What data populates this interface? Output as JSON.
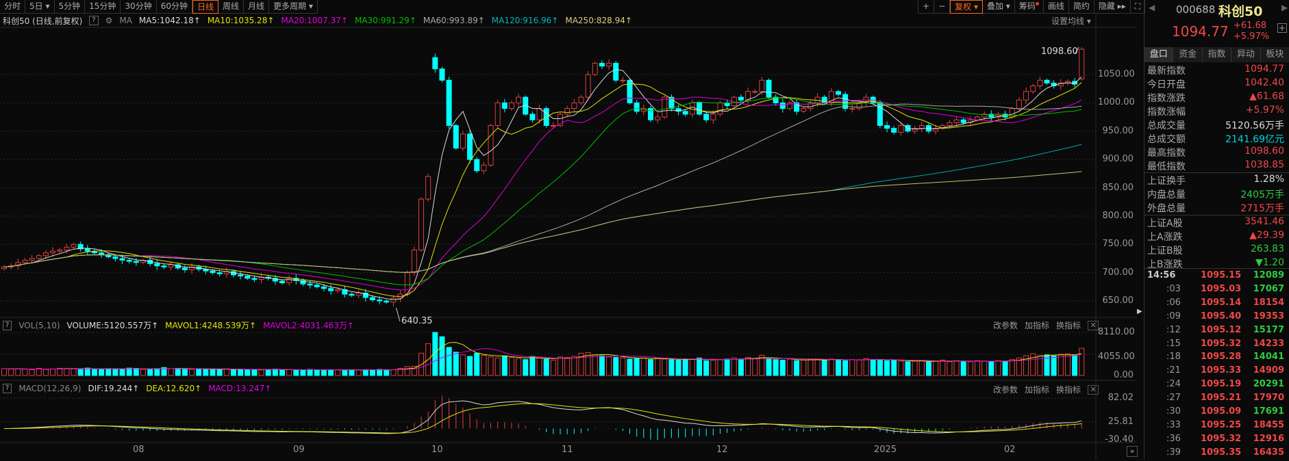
{
  "toolbar": {
    "periods": [
      "分时",
      "5日 ▾",
      "5分钟",
      "15分钟",
      "30分钟",
      "60分钟",
      "日线",
      "周线",
      "月线",
      "更多周期 ▾"
    ],
    "active_period": "日线",
    "right": {
      "plus": "+",
      "minus": "−",
      "fuquan": "复权 ▾",
      "overlay": "叠加 ▾",
      "chips": "筹码",
      "draw": "画线",
      "simple": "简约",
      "hide": "隐藏 ▸▸",
      "fullscreen": "⛶"
    }
  },
  "info": {
    "title": "科创50 (日线,前复权)",
    "help": "?",
    "ma_label": "MA",
    "ma5": "MA5:1042.18↑",
    "ma10": "MA10:1035.28↑",
    "ma20": "MA20:1007.37↑",
    "ma30": "MA30:991.29↑",
    "ma60": "MA60:993.89↑",
    "ma120": "MA120:916.96↑",
    "ma250": "MA250:828.94↑",
    "set_ma": "设置均线 ▾"
  },
  "colors": {
    "up": "#e04040",
    "down": "#00ffff",
    "ma5": "#dddddd",
    "ma10": "#e6e600",
    "ma20": "#e000e0",
    "ma30": "#00c000",
    "ma60": "#aaaaaa",
    "ma120": "#00a8b0",
    "ma250": "#c8c070"
  },
  "price_axis": [
    "1050.00",
    "1000.00",
    "950.00",
    "900.00",
    "850.00",
    "800.00",
    "750.00",
    "700.00",
    "650.00"
  ],
  "annotations": {
    "high": "1098.60",
    "low": "640.35"
  },
  "vol": {
    "help": "?",
    "name": "VOL(5,10)",
    "volume": "VOLUME:5120.557万↑",
    "mavol1": "MAVOL1:4248.539万↑",
    "mavol2": "MAVOL2:4031.463万↑",
    "axis": [
      "8110.00",
      "4055.00",
      "0.00"
    ]
  },
  "macd": {
    "help": "?",
    "name": "MACD(12,26,9)",
    "dif": "DIF:19.244↑",
    "dea": "DEA:12.620↑",
    "macd": "MACD:13.247↑",
    "axis": [
      "82.02",
      "25.81",
      "-30.40"
    ]
  },
  "sub_buttons": {
    "params": "改参数",
    "add": "加指标",
    "swap": "换指标",
    "close": "✕"
  },
  "months": [
    "08",
    "09",
    "10",
    "11",
    "12",
    "2025",
    "02"
  ],
  "chart_data": {
    "type": "candlestick",
    "y_range": [
      620,
      1110
    ],
    "closes": [
      710,
      712,
      718,
      722,
      725,
      730,
      735,
      738,
      740,
      745,
      750,
      742,
      738,
      735,
      732,
      728,
      725,
      722,
      720,
      718,
      722,
      716,
      712,
      710,
      714,
      708,
      705,
      710,
      706,
      703,
      700,
      698,
      702,
      696,
      694,
      690,
      688,
      692,
      690,
      685,
      682,
      690,
      686,
      680,
      678,
      675,
      672,
      668,
      670,
      662,
      660,
      664,
      656,
      652,
      650,
      648,
      655,
      662,
      700,
      740,
      830,
      870,
      1060,
      1040,
      960,
      920,
      945,
      900,
      880,
      890,
      960,
      1000,
      990,
      1000,
      1010,
      980,
      970,
      990,
      960,
      960,
      980,
      990,
      1000,
      1010,
      1050,
      1070,
      1065,
      1070,
      1040,
      1040,
      1000,
      985,
      990,
      970,
      975,
      1010,
      990,
      985,
      980,
      1000,
      980,
      970,
      980,
      1000,
      995,
      1010,
      1005,
      1020,
      1020,
      1040,
      1010,
      1000,
      990,
      1000,
      985,
      990,
      1000,
      1010,
      1000,
      1020,
      1015,
      990,
      990,
      1000,
      1010,
      1000,
      960,
      955,
      948,
      960,
      950,
      955,
      960,
      950,
      955,
      960,
      965,
      970,
      965,
      970,
      975,
      980,
      975,
      980,
      975,
      990,
      1005,
      1020,
      1030,
      1040,
      1035,
      1030,
      1035,
      1038,
      1033,
      1094.77
    ],
    "volumes": [
      1300,
      1200,
      1250,
      1200,
      1100,
      1350,
      1150,
      1250,
      1350,
      1300,
      1300,
      1200,
      1400,
      1250,
      1150,
      1300,
      1250,
      1150,
      1400,
      1350,
      1150,
      1200,
      1300,
      1500,
      1300,
      1350,
      1250,
      1150,
      1300,
      1200,
      1100,
      1150,
      1250,
      1100,
      1200,
      1100,
      1150,
      1050,
      1100,
      1200,
      1050,
      1100,
      1000,
      1050,
      1150,
      1100,
      1050,
      1100,
      1050,
      1000,
      1100,
      1050,
      1100,
      1050,
      1150,
      1050,
      1100,
      1350,
      1700,
      1750,
      4200,
      6000,
      8110,
      7300,
      5300,
      4400,
      3900,
      3600,
      4200,
      3800,
      3500,
      3300,
      3700,
      3400,
      3200,
      3000,
      3600,
      3300,
      3100,
      2900,
      3500,
      3400,
      3600,
      4200,
      4300,
      3900,
      3700,
      3500,
      3400,
      3300,
      3100,
      3200,
      3300,
      3000,
      3300,
      3100,
      3000,
      2900,
      3100,
      3000,
      3300,
      2800,
      2900,
      3000,
      3100,
      3300,
      3100,
      3400,
      3200,
      3800,
      3200,
      3000,
      2900,
      3100,
      2800,
      2900,
      3000,
      3100,
      2900,
      3100,
      3000,
      2800,
      3000,
      2900,
      3200,
      3000,
      3000,
      2800,
      2900,
      2700,
      2600,
      2700,
      2800,
      2600,
      2700,
      2900,
      2600,
      2800,
      2700,
      2600,
      2800,
      2700,
      2600,
      2800,
      2700,
      3000,
      3300,
      3700,
      4100,
      3800,
      3900,
      3700,
      4000,
      4100,
      3800,
      5120
    ],
    "last_open": 1042.4,
    "last_high": 1098.6,
    "low_point": 640.35,
    "vol_range": [
      0,
      8110
    ],
    "macd_range": [
      -30.4,
      82.02
    ]
  },
  "panel": {
    "code": "000688",
    "name": "科创50",
    "price": "1094.77",
    "change": "+61.68",
    "pct": "+5.97%",
    "add": "+",
    "tabs": [
      "盘口",
      "资金",
      "指数",
      "异动",
      "板块"
    ],
    "rows": [
      {
        "k": "最新指数",
        "v": "1094.77",
        "c": "red"
      },
      {
        "k": "今日开盘",
        "v": "1042.40",
        "c": "red"
      },
      {
        "k": "指数涨跌",
        "v": "▲61.68",
        "c": "red"
      },
      {
        "k": "指数涨幅",
        "v": "+5.97%",
        "c": "red"
      },
      {
        "k": "总成交量",
        "v": "5120.56万手",
        "c": "wht"
      },
      {
        "k": "总成交额",
        "v": "2141.69亿元",
        "c": "cyan"
      },
      {
        "k": "最高指数",
        "v": "1098.60",
        "c": "red"
      },
      {
        "k": "最低指数",
        "v": "1038.85",
        "c": "red"
      }
    ],
    "rows2": [
      {
        "k": "上证换手",
        "v": "1.28%",
        "c": "wht"
      },
      {
        "k": "内盘总量",
        "v": "2405万手",
        "c": "grn"
      },
      {
        "k": "外盘总量",
        "v": "2715万手",
        "c": "red"
      }
    ],
    "rows3": [
      {
        "k": "上证A股",
        "v": "3541.46",
        "c": "red"
      },
      {
        "k": "上A涨跌",
        "v": "▲29.39",
        "c": "red"
      },
      {
        "k": "上证B股",
        "v": "263.83",
        "c": "grn"
      },
      {
        "k": "上B涨跌",
        "v": "▼1.20",
        "c": "grn"
      }
    ],
    "ticks": [
      {
        "t": "14:56",
        "p": "1095.15",
        "v": "12089",
        "c": "grn"
      },
      {
        "t": ":03",
        "p": "1095.03",
        "v": "17067",
        "c": "grn"
      },
      {
        "t": ":06",
        "p": "1095.14",
        "v": "18154",
        "c": "red"
      },
      {
        "t": ":09",
        "p": "1095.40",
        "v": "19353",
        "c": "red"
      },
      {
        "t": ":12",
        "p": "1095.12",
        "v": "15177",
        "c": "grn"
      },
      {
        "t": ":15",
        "p": "1095.32",
        "v": "14233",
        "c": "red"
      },
      {
        "t": ":18",
        "p": "1095.28",
        "v": "14041",
        "c": "grn"
      },
      {
        "t": ":21",
        "p": "1095.33",
        "v": "14909",
        "c": "red"
      },
      {
        "t": ":24",
        "p": "1095.19",
        "v": "20291",
        "c": "grn"
      },
      {
        "t": ":27",
        "p": "1095.21",
        "v": "17970",
        "c": "red"
      },
      {
        "t": ":30",
        "p": "1095.09",
        "v": "17691",
        "c": "grn"
      },
      {
        "t": ":33",
        "p": "1095.25",
        "v": "18455",
        "c": "red"
      },
      {
        "t": ":36",
        "p": "1095.32",
        "v": "12916",
        "c": "red"
      },
      {
        "t": ":39",
        "p": "1095.35",
        "v": "16435",
        "c": "red"
      }
    ]
  }
}
